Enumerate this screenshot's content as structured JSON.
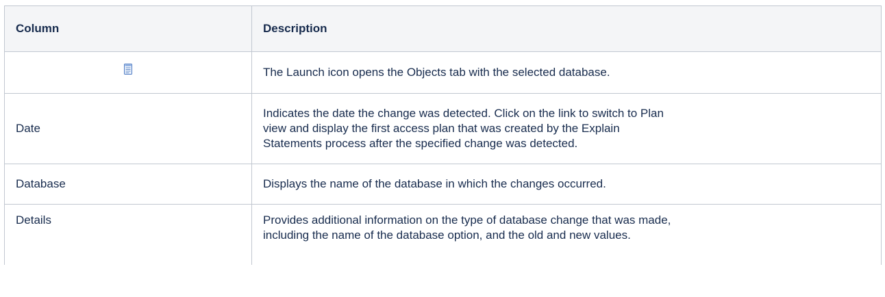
{
  "table": {
    "headers": [
      "Column",
      "Description"
    ],
    "rows": [
      {
        "column": "",
        "icon": "document-icon",
        "description": "The Launch icon opens the Objects tab with the selected database."
      },
      {
        "column": "Date",
        "description_lines": [
          "Indicates the date the change was detected. Click on the link to switch to Plan",
          "view and display the first access plan that was created by the Explain",
          "Statements process after the specified change was detected."
        ]
      },
      {
        "column": "Database",
        "description": "Displays the name of the database in which the changes occurred."
      },
      {
        "column": "Details",
        "description_lines": [
          "Provides additional information on the type of database change that was made,",
          "including the name of the database option, and the old and new values."
        ]
      }
    ]
  },
  "colors": {
    "border": "#c1c7d0",
    "header_bg": "#f4f5f7",
    "text": "#172b4d",
    "icon_blue": "#4a78c2"
  }
}
